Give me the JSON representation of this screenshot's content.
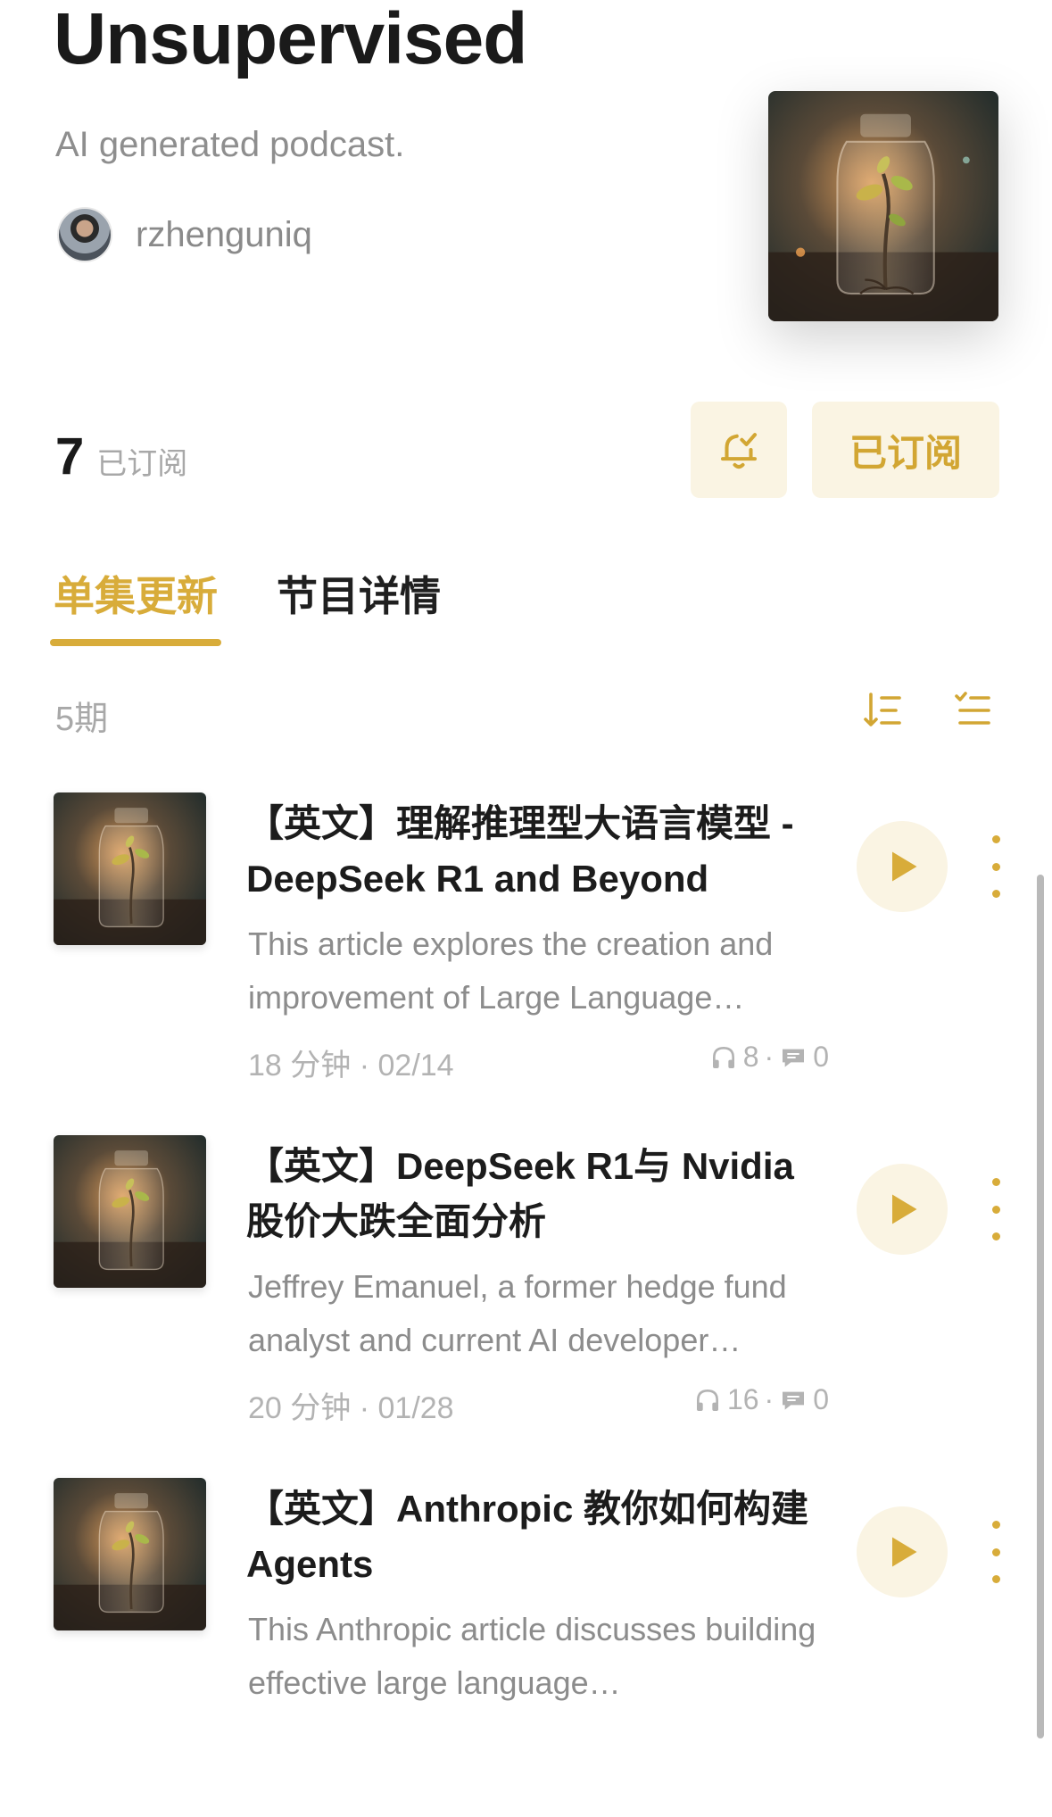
{
  "podcast": {
    "title": "Unsupervised",
    "subtitle": "AI generated podcast.",
    "author": "rzhenguniq"
  },
  "subscription": {
    "count": "7",
    "count_label": "已订阅",
    "subscribe_button": "已订阅",
    "bell_icon": "bell-check-icon"
  },
  "tabs": [
    {
      "label": "单集更新",
      "active": true
    },
    {
      "label": "节目详情",
      "active": false
    }
  ],
  "episode_count": "5期",
  "episodes": [
    {
      "title": "【英文】理解推理型大语言模型 - DeepSeek R1 and Beyond",
      "description": "This article explores the creation and improvement of Large Language Models…",
      "duration": "18 分钟",
      "date": "02/14",
      "listens": "8",
      "comments": "0"
    },
    {
      "title": "【英文】DeepSeek R1与 Nvidia 股价大跌全面分析",
      "description": "Jeffrey Emanuel, a former hedge fund analyst and current AI developer…",
      "duration": "20 分钟",
      "date": "01/28",
      "listens": "16",
      "comments": "0"
    },
    {
      "title": "【英文】Anthropic 教你如何构建 Agents",
      "description": "This Anthropic article discusses building effective large language…",
      "duration": "",
      "date": "",
      "listens": "",
      "comments": ""
    }
  ],
  "colors": {
    "accent": "#d8ac3a",
    "accent_bg": "#faf4e3",
    "muted": "#8c8c8c"
  }
}
